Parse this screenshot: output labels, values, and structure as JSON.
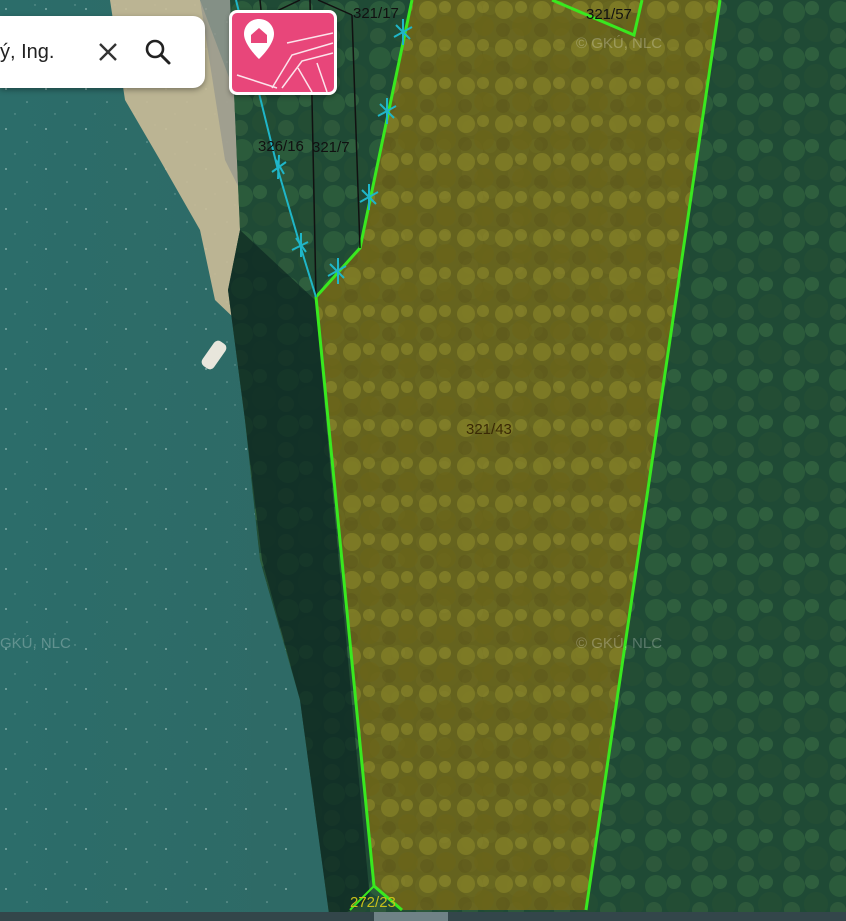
{
  "search": {
    "value": "ý, Ing."
  },
  "map": {
    "parcel_labels": [
      "321/17",
      "321/57",
      "326/16",
      "321/7",
      "321/43",
      "272/23"
    ],
    "watermarks": [
      "© GKÚ, NLC",
      "GKÚ, NLC",
      "© GKÚ, NLC"
    ],
    "colors": {
      "water": "#2f6a66",
      "forest": "#1f4a35",
      "parcel_fill": "#7a6a18",
      "parcel_outline": "#39e81f",
      "boundary_cyan": "#1fb6c8",
      "layer_button": "#e8467a"
    }
  },
  "icons": {
    "close": "close-icon",
    "search": "search-icon",
    "layer": "cadastre-layer-icon"
  }
}
